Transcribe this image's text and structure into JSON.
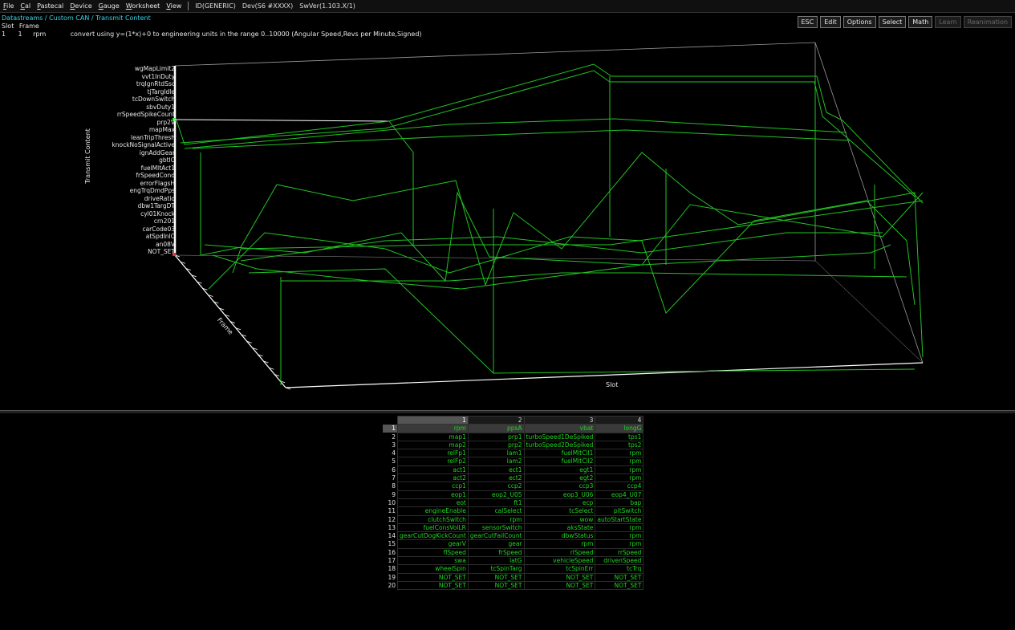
{
  "menu": {
    "items": [
      {
        "u": "F",
        "rest": "ile"
      },
      {
        "u": "C",
        "rest": "al"
      },
      {
        "u": "P",
        "rest": "astecal"
      },
      {
        "u": "D",
        "rest": "evice"
      },
      {
        "u": "G",
        "rest": "auge"
      },
      {
        "u": "W",
        "rest": "orksheet"
      },
      {
        "u": "V",
        "rest": "iew"
      }
    ],
    "info": [
      "ID(GENERIC)",
      "Dev(S6 #XXXX)",
      "SwVer(1.103.X/1)"
    ]
  },
  "breadcrumb": "Datastreams / Custom CAN / Transmit Content",
  "header": {
    "slot": "Slot",
    "frame": "Frame"
  },
  "current_row": {
    "slot": "1",
    "frame": "1",
    "name": "rpm",
    "description": "convert using y=(1*x)+0 to engineering units in the range 0..10000 (Angular Speed,Revs per Minute,Signed)"
  },
  "toolbar": {
    "buttons": [
      {
        "label": "ESC",
        "dim": false
      },
      {
        "label": "Edit",
        "ul": "E",
        "dim": false
      },
      {
        "label": "Options",
        "ul": "O",
        "dim": false
      },
      {
        "label": "Select",
        "ul": "S",
        "dim": false
      },
      {
        "label": "Math",
        "ul": "M",
        "dim": false
      },
      {
        "label": "Learn",
        "dim": true
      },
      {
        "label": "Reanimation",
        "ul": "R",
        "dim": true
      }
    ]
  },
  "chart_data": {
    "type": "3d-line-surface",
    "zlabel": "Transmit Content",
    "ylabel": "Frame",
    "xlabel": "Slot",
    "z_categories": [
      "wgMapLimit2",
      "vvt1InDuty",
      "trqIgnRtdSsc",
      "tjTargIdle",
      "tcDownSwitch",
      "sbvDuty1",
      "rrSpeedSpikeCount",
      "prp2V",
      "mapMax",
      "leanTripThresh",
      "knockNoSignalActive",
      "ignAddGear",
      "gbtIC",
      "fuelMltAct1",
      "frSpeedCond",
      "errorFlagsH",
      "engTrqDmdPps",
      "driveRatio",
      "dbw1TargDT",
      "cyl01Knock",
      "crn201",
      "carCode03",
      "atSpdInIC",
      "an08V",
      "NOT_SET"
    ],
    "line_color": "#22c422",
    "axis_color": "#ffffff"
  },
  "grid": {
    "columns": [
      "1",
      "2",
      "3",
      "4"
    ],
    "selected_row": 1,
    "rows": [
      [
        "rpm",
        "ppsA",
        "vbat",
        "longG"
      ],
      [
        "map1",
        "prp1",
        "turboSpeed1DeSpiked",
        "tps1"
      ],
      [
        "map2",
        "prp2",
        "turboSpeed2DeSpiked",
        "tps2"
      ],
      [
        "relFp1",
        "lam1",
        "fuelMltCll1",
        "rpm"
      ],
      [
        "relFp2",
        "lam2",
        "fuelMltCll2",
        "rpm"
      ],
      [
        "act1",
        "ect1",
        "egt1",
        "rpm"
      ],
      [
        "act2",
        "ect2",
        "egt2",
        "rpm"
      ],
      [
        "ccp1",
        "ccp2",
        "ccp3",
        "ccp4"
      ],
      [
        "eop1",
        "eop2_U05",
        "eop3_U06",
        "eop4_U07"
      ],
      [
        "eot",
        "ft1",
        "ecp",
        "bap"
      ],
      [
        "engineEnable",
        "calSelect",
        "tcSelect",
        "pitSwitch"
      ],
      [
        "clutchSwitch",
        "rpm",
        "wow",
        "autoStartState"
      ],
      [
        "fuelConsVolLR",
        "sensorSwitch",
        "aksState",
        "rpm"
      ],
      [
        "gearCutDogKickCount",
        "gearCutFailCount",
        "dbwStatus",
        "rpm"
      ],
      [
        "gearV",
        "gear",
        "rpm",
        "rpm"
      ],
      [
        "flSpeed",
        "frSpeed",
        "rlSpeed",
        "rrSpeed"
      ],
      [
        "swa",
        "latG",
        "vehicleSpeed",
        "drivenSpeed"
      ],
      [
        "wheelSpin",
        "tcSpinTarg",
        "tcSpinErr",
        "tcTrq"
      ],
      [
        "NOT_SET",
        "NOT_SET",
        "NOT_SET",
        "NOT_SET"
      ],
      [
        "NOT_SET",
        "NOT_SET",
        "NOT_SET",
        "NOT_SET"
      ]
    ]
  }
}
